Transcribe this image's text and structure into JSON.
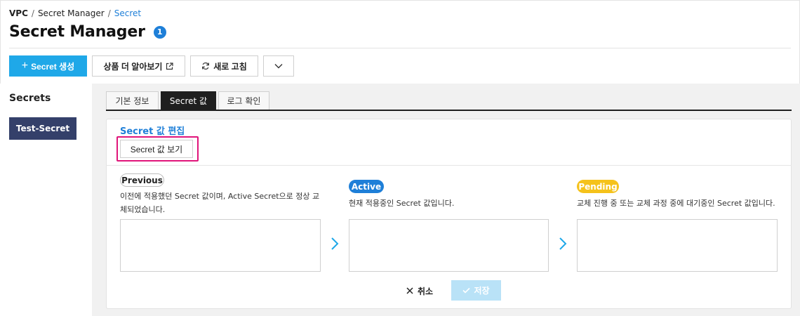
{
  "breadcrumb": {
    "items": [
      "VPC",
      "Secret Manager",
      "Secret"
    ],
    "separator": "/"
  },
  "header": {
    "title": "Secret Manager",
    "count": "1"
  },
  "toolbar": {
    "create_label": "Secret 생성",
    "learn_label": "상품 더 알아보기",
    "refresh_label": "새로 고침"
  },
  "sidebar": {
    "heading": "Secrets",
    "items": [
      {
        "label": "Test-Secret"
      }
    ]
  },
  "tabs": [
    {
      "label": "기본 정보",
      "active": false
    },
    {
      "label": "Secret 값",
      "active": true
    },
    {
      "label": "로그 확인",
      "active": false
    }
  ],
  "editor": {
    "title": "Secret 값 편집",
    "view_button": "Secret 값 보기",
    "states": {
      "previous": {
        "label": "Previous",
        "description": "이전에 적용했던 Secret 값이며, Active Secret으로 정상 교체되었습니다."
      },
      "active": {
        "label": "Active",
        "description": "현재 적용중인 Secret 값입니다."
      },
      "pending": {
        "label": "Pending",
        "description": "교체 진행 중 또는 교체 과정 중에 대기중인 Secret 값입니다."
      }
    },
    "cancel_label": "취소",
    "save_label": "저장"
  },
  "colors": {
    "accent": "#1e7fd8",
    "primary_button": "#1fa8e8",
    "sidebar_selected": "#34406a",
    "pending": "#f5c21b",
    "highlight": "#e0157a",
    "save_disabled": "#b9e2f7"
  },
  "icons": {
    "create": "plus-icon",
    "learn": "external-link-icon",
    "refresh": "refresh-icon",
    "more": "chevron-down-icon",
    "arrow": "chevron-right-icon",
    "cancel": "close-icon",
    "save": "check-icon"
  }
}
